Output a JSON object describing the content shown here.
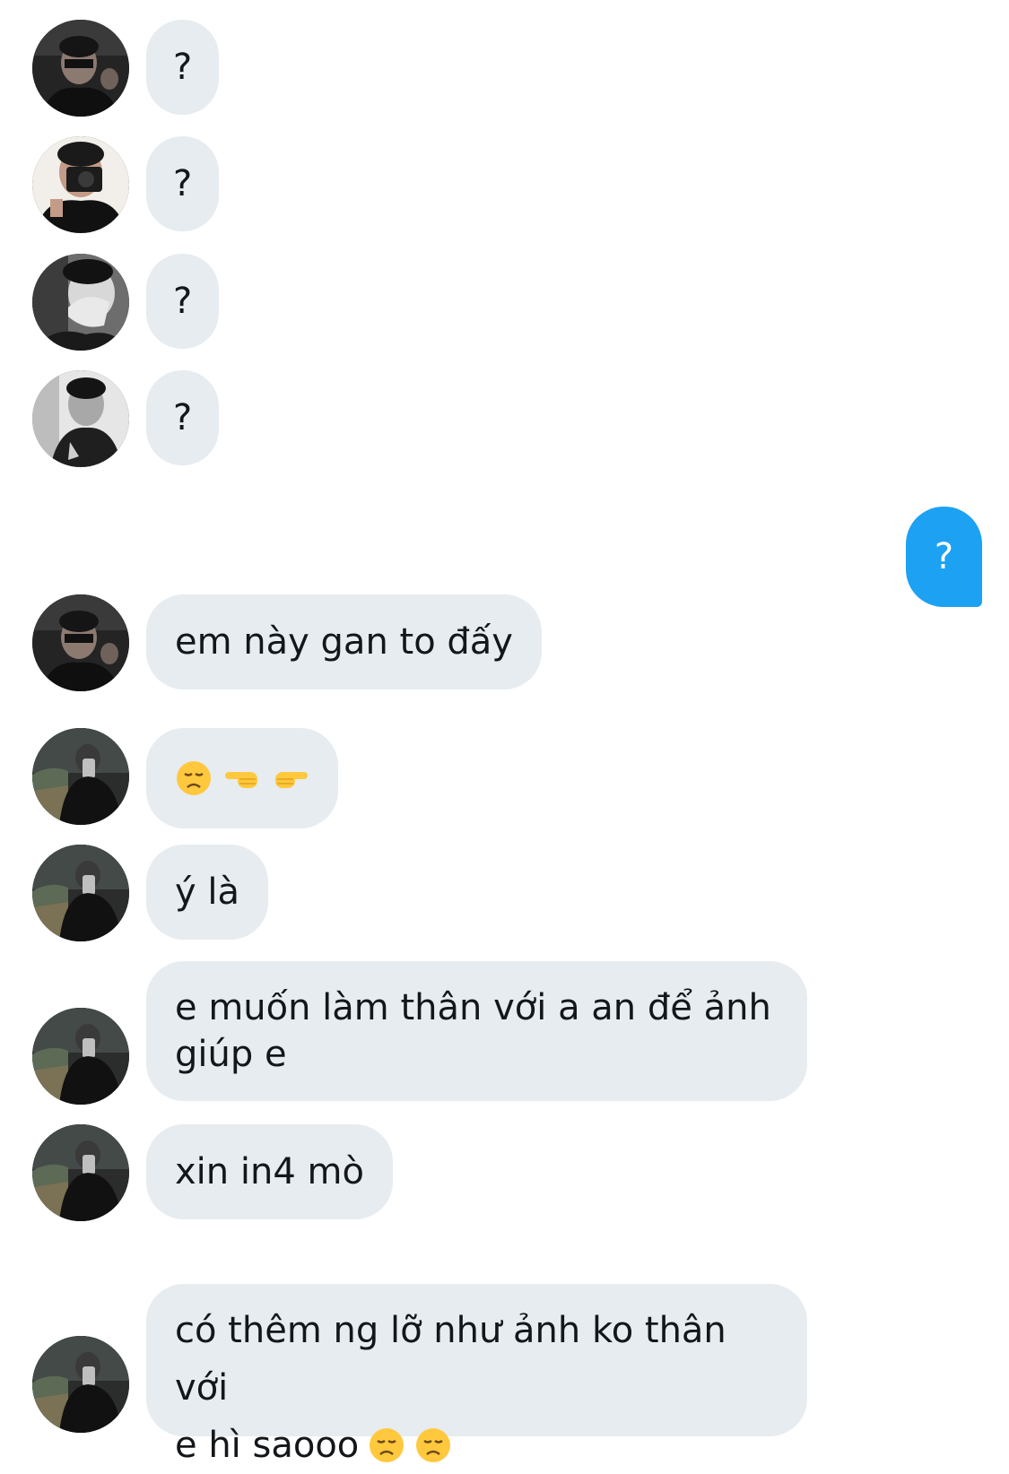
{
  "messages": [
    {
      "sender": "avatar-a",
      "text": "?"
    },
    {
      "sender": "avatar-b",
      "text": "?"
    },
    {
      "sender": "avatar-c",
      "text": "?"
    },
    {
      "sender": "avatar-d",
      "text": "?"
    },
    {
      "sender": "me",
      "text": "?"
    },
    {
      "sender": "avatar-a",
      "text": "em này gan to đấy"
    },
    {
      "sender": "avatar-e",
      "emojis": [
        "disappointed-face-emoji",
        "backhand-index-pointing-left-emoji",
        "backhand-index-pointing-right-emoji"
      ]
    },
    {
      "sender": "avatar-e",
      "text": "ý là"
    },
    {
      "sender": "avatar-e",
      "line1": "e muốn làm thân với a an để ảnh",
      "line2": "giúp e"
    },
    {
      "sender": "avatar-e",
      "text": "xin in4 mò"
    },
    {
      "sender": "avatar-e",
      "line1": "có thêm ng lỡ như ảnh ko thân với",
      "line2": "e hì saooo",
      "line2_emojis": [
        "disappointed-face-emoji",
        "disappointed-face-emoji"
      ]
    }
  ],
  "colors": {
    "incoming_bubble": "#e6ecf0",
    "outgoing_bubble": "#1da1f2",
    "text": "#14171a"
  }
}
